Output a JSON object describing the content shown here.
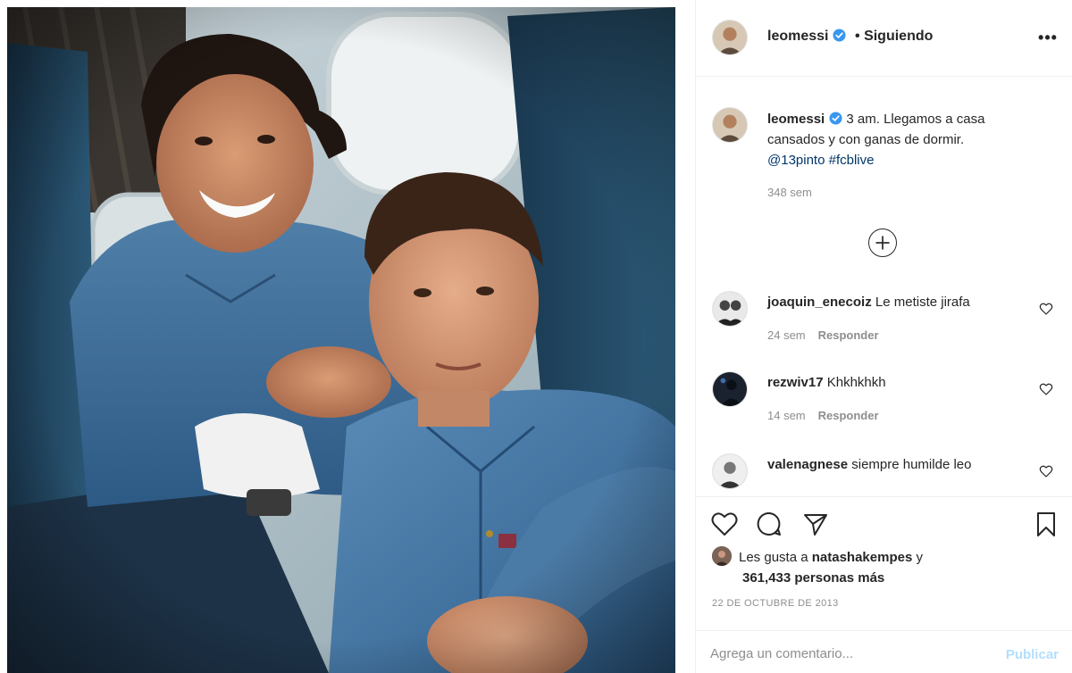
{
  "post": {
    "photo_alt": "",
    "account": {
      "username": "leomessi",
      "verified_icon": "verified-badge-icon",
      "separator": "•",
      "follow_state": "Siguiendo"
    },
    "more_options_label": "•••",
    "caption": {
      "username": "leomessi",
      "text": "3 am. Llegamos a casa cansados y con ganas de dormir.",
      "mention": "@13pinto",
      "hashtag": "#fcblive",
      "time": "348 sem"
    },
    "comments": [
      {
        "username": "joaquin_enecoiz",
        "text": "Le metiste jirafa",
        "time": "24 sem",
        "reply_label": "Responder"
      },
      {
        "username": "rezwiv17",
        "text": "Khkhkhkh",
        "time": "14 sem",
        "reply_label": "Responder"
      },
      {
        "username": "valenagnese",
        "text": "siempre humilde leo",
        "time": "",
        "reply_label": ""
      }
    ],
    "likes": {
      "prefix": "Les gusta a",
      "liker": "natashakempes",
      "connector": "y",
      "count_text": "361,433 personas más"
    },
    "date": "22 DE OCTUBRE DE 2013",
    "add_comment": {
      "placeholder": "Agrega un comentario...",
      "publish_label": "Publicar"
    },
    "colors": {
      "accent_link": "#00376b",
      "verified_blue": "#3897f0",
      "muted": "#8e8e8e",
      "publish_disabled": "#b2dffc"
    }
  }
}
